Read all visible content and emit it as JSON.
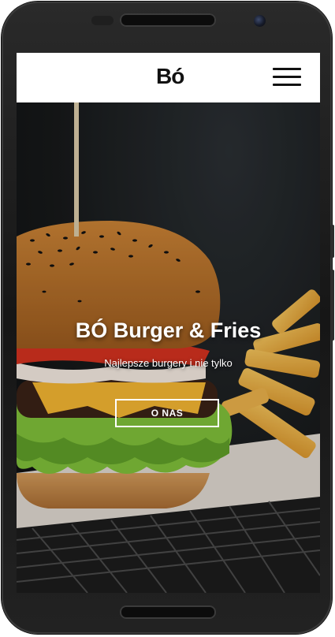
{
  "navbar": {
    "logo": "Bó"
  },
  "hero": {
    "title": "BÓ Burger & Fries",
    "subtitle": "Najlepsze burgery i nie tylko",
    "button_label": "O NAS"
  },
  "icons": {
    "menu": "hamburger-menu-icon"
  }
}
